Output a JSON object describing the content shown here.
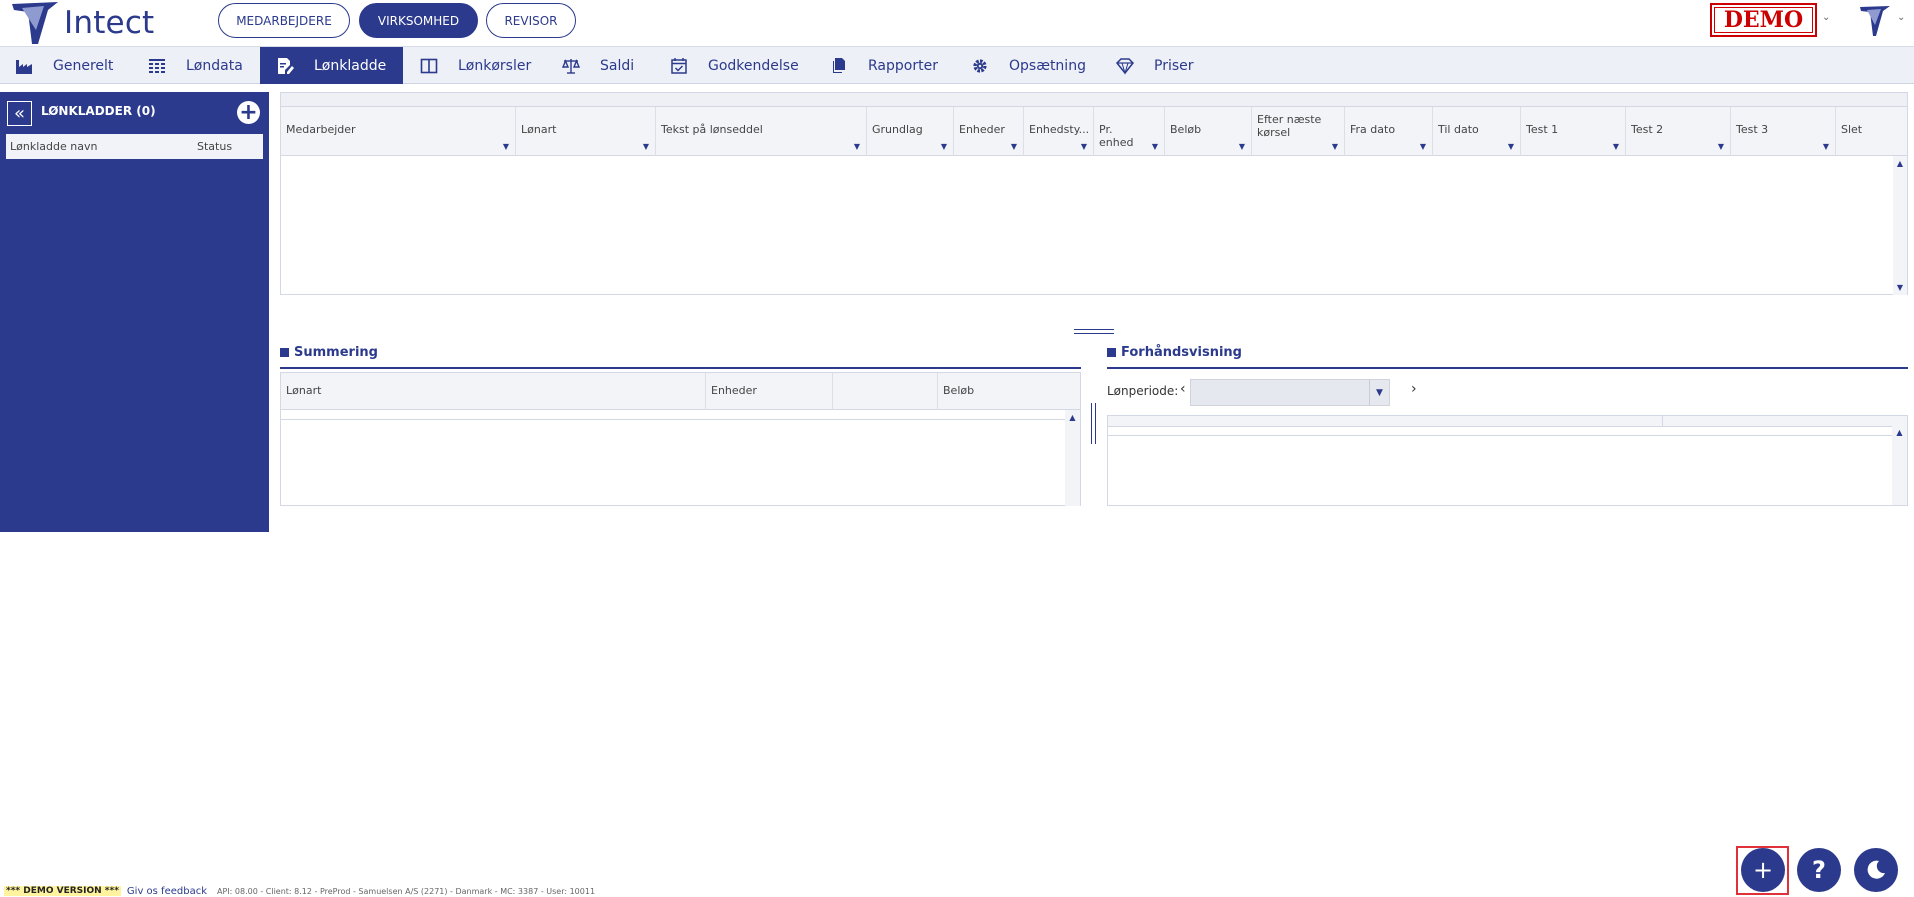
{
  "app": {
    "logo_text": "Intect"
  },
  "header": {
    "roles": [
      "MEDARBEJDERE",
      "VIRKSOMHED",
      "REVISOR"
    ],
    "active_role": "VIRKSOMHED",
    "demo_label": "DEMO"
  },
  "nav": {
    "items": [
      {
        "label": "Generelt",
        "icon": "factory-icon"
      },
      {
        "label": "Løndata",
        "icon": "grid-icon"
      },
      {
        "label": "Lønkladde",
        "icon": "edit-document-icon"
      },
      {
        "label": "Lønkørsler",
        "icon": "columns-icon"
      },
      {
        "label": "Saldi",
        "icon": "balance-scale-icon"
      },
      {
        "label": "Godkendelse",
        "icon": "calendar-check-icon"
      },
      {
        "label": "Rapporter",
        "icon": "copy-documents-icon"
      },
      {
        "label": "Opsætning",
        "icon": "gear-icon"
      },
      {
        "label": "Priser",
        "icon": "diamond-icon"
      }
    ],
    "active": "Lønkladde"
  },
  "sidebar": {
    "title": "LØNKLADDER (0)",
    "columns": [
      "Lønkladde navn",
      "Status"
    ]
  },
  "grid": {
    "columns": [
      "Medarbejder",
      "Lønart",
      "Tekst på lønseddel",
      "Grundlag",
      "Enheder",
      "Enhedsty...",
      "Pr. enhed",
      "Beløb",
      "Efter næste kørsel",
      "Fra dato",
      "Til dato",
      "Test 1",
      "Test 2",
      "Test 3",
      "Slet"
    ]
  },
  "summary": {
    "title": "Summering",
    "columns": [
      "Lønart",
      "Enheder",
      "",
      "Beløb"
    ]
  },
  "preview": {
    "title": "Forhåndsvisning",
    "period_label": "Lønperiode:",
    "period_value": ""
  },
  "footer": {
    "demo_version": "*** DEMO VERSION ***",
    "feedback": "Giv os feedback",
    "info": "API: 08.00 - Client: 8.12 - PreProd - Samuelsen A/S (2271) - Danmark - MC: 3387 - User: 10011"
  },
  "fabs": {
    "add": "+",
    "help": "?"
  },
  "colors": {
    "brand": "#2b3a8c",
    "demo_red": "#cc0000",
    "highlight_outline": "#e0313a"
  }
}
